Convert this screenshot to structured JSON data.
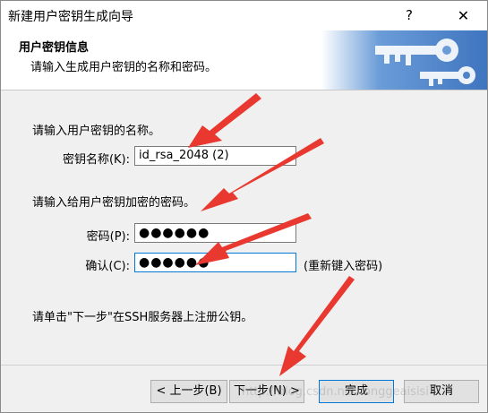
{
  "window": {
    "title": "新建用户密钥生成向导",
    "help": "?",
    "close": "✕"
  },
  "header": {
    "title": "用户密钥信息",
    "subtitle": "请输入生成用户密钥的名称和密码。"
  },
  "form": {
    "name_prompt": "请输入用户密钥的名称。",
    "key_name_label": "密钥名称(K):",
    "key_name_value": "id_rsa_2048 (2)",
    "password_prompt": "请输入给用户密钥加密的密码。",
    "password_label": "密码(P):",
    "password_value": "●●●●●●",
    "confirm_label": "确认(C):",
    "confirm_value": "●●●●●●",
    "reenter_hint": "(重新键入密码)",
    "next_hint": "请单击\"下一步\"在SSH服务器上注册公钥。"
  },
  "buttons": {
    "back": "< 上一步(B)",
    "next": "下一步(N) >",
    "finish": "完成",
    "cancel": "取消"
  },
  "watermark": "http://blog.csdn.net/longgeaisisi",
  "colors": {
    "annotation_red": "#e8382f",
    "focus_border": "#0078d7",
    "art_blue": "#5b8fd0"
  }
}
